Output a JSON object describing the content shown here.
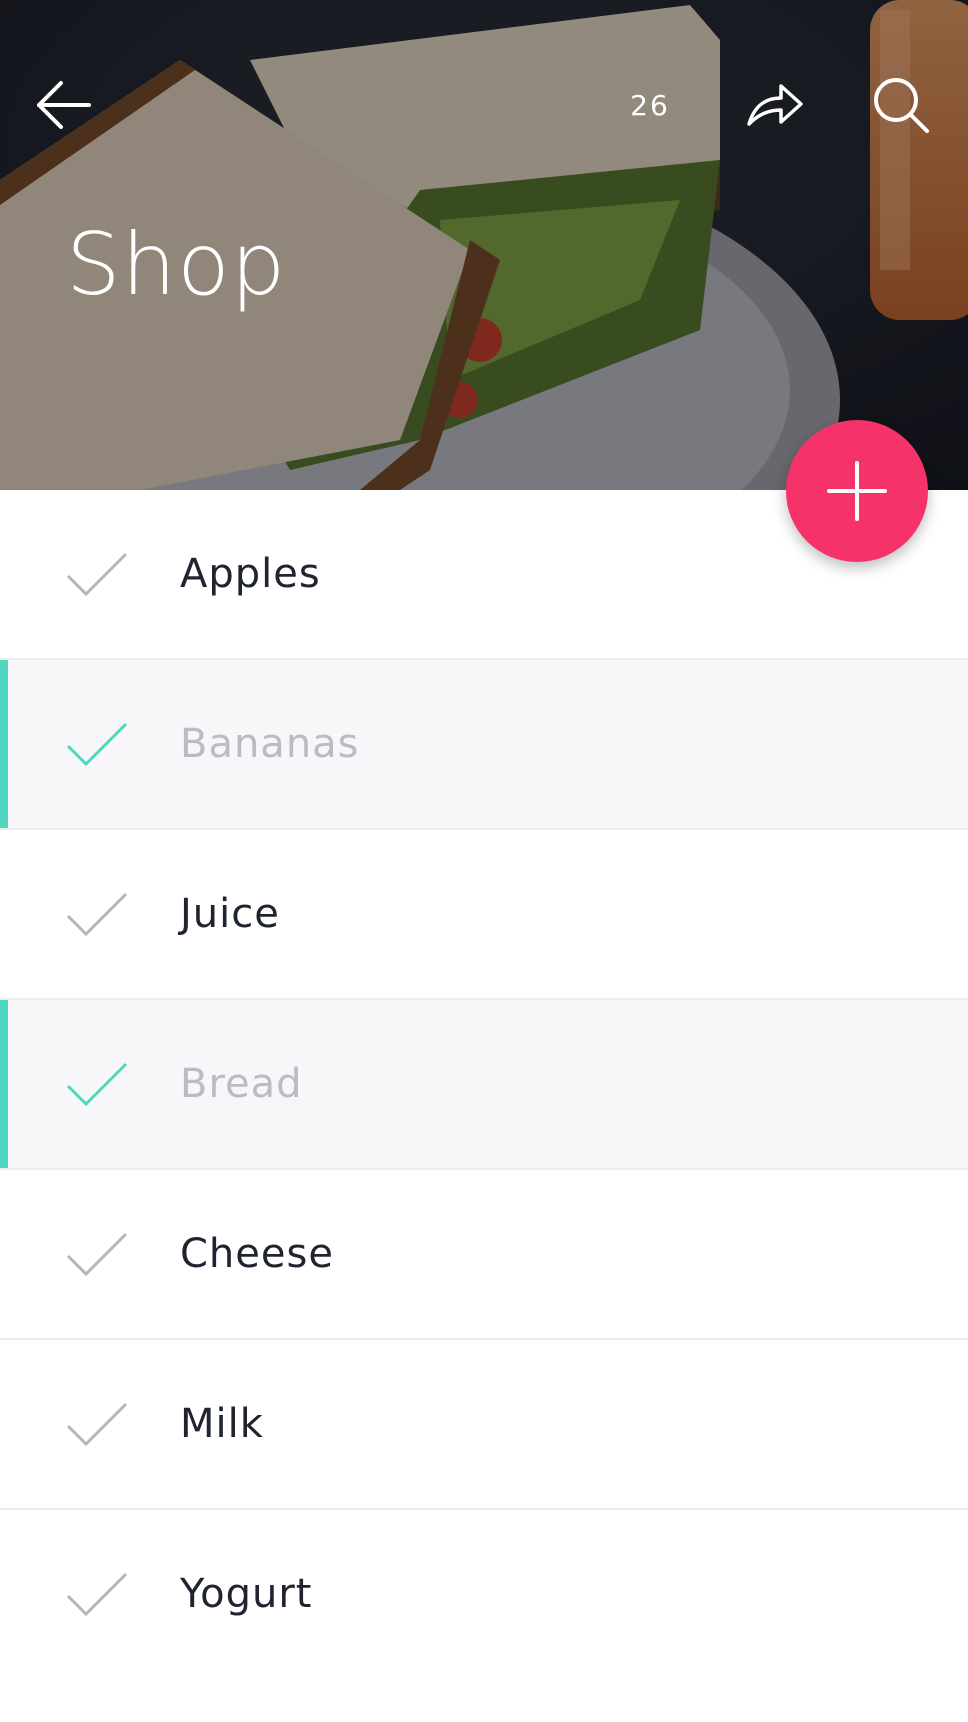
{
  "header": {
    "title": "Shop",
    "count": "26"
  },
  "colors": {
    "accent": "#4fd6c0",
    "fab": "#f5336a",
    "done_text": "#b9bcc4",
    "text": "#1f2430"
  },
  "icons": {
    "back": "arrow-left-icon",
    "share": "share-arrow-icon",
    "search": "search-icon",
    "add": "plus-icon",
    "check": "checkmark-icon"
  },
  "items": [
    {
      "label": "Apples",
      "done": false
    },
    {
      "label": "Bananas",
      "done": true
    },
    {
      "label": "Juice",
      "done": false
    },
    {
      "label": "Bread",
      "done": true
    },
    {
      "label": "Cheese",
      "done": false
    },
    {
      "label": "Milk",
      "done": false
    },
    {
      "label": "Yogurt",
      "done": false
    }
  ]
}
